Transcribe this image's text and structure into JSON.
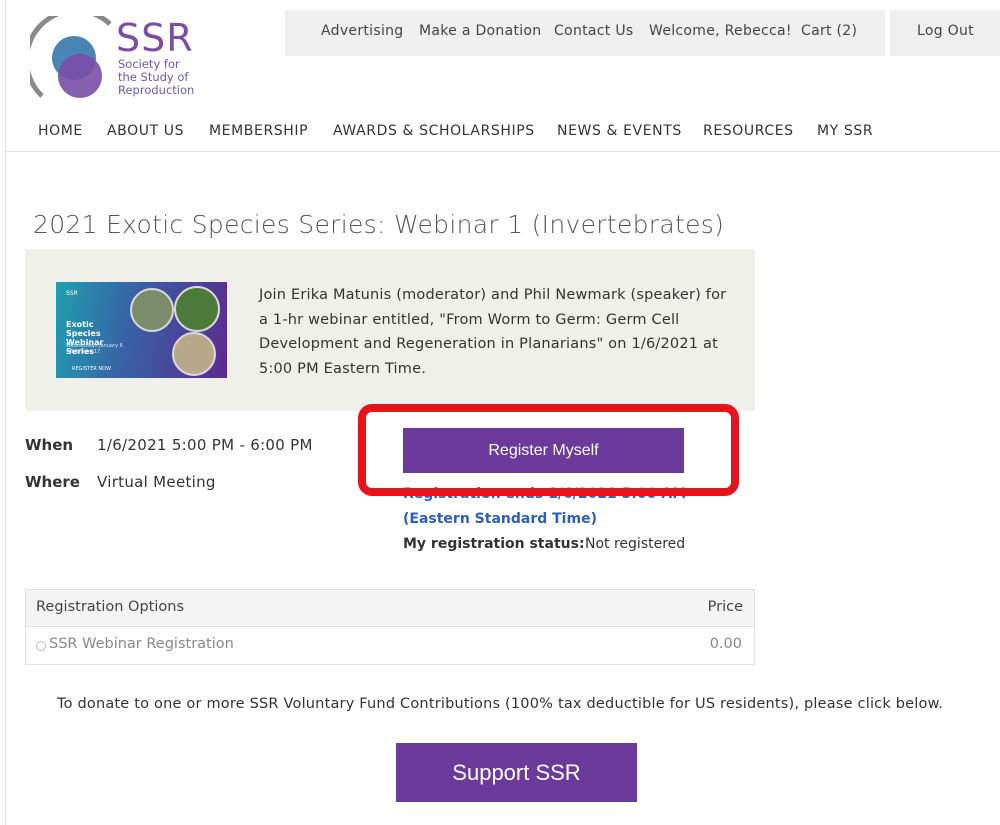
{
  "brand": {
    "name": "SSR",
    "subtitle_lines": [
      "Society for",
      "the Study of",
      "Reproduction"
    ]
  },
  "topbar": {
    "advertising": "Advertising",
    "donation": "Make a Donation",
    "contact": "Contact Us",
    "welcome": "Welcome, Rebecca!",
    "cart": "Cart (2)",
    "logout": "Log Out"
  },
  "nav": {
    "items": [
      "HOME",
      "ABOUT US",
      "MEMBERSHIP",
      "AWARDS & SCHOLARSHIPS",
      "NEWS & EVENTS",
      "RESOURCES",
      "MY SSR"
    ]
  },
  "event": {
    "title": "2021 Exotic Species Series: Webinar 1 (Invertebrates)",
    "thumbnail": {
      "logo": "SSR",
      "title": "Exotic Species Webinar Series",
      "dates": "Wednesdays January 6 – February 17",
      "cta": "REGISTER NOW"
    },
    "description": "Join Erika Matunis (moderator) and Phil Newmark (speaker) for a 1-hr webinar entitled, \"From Worm to Germ: Germ Cell Development and Regeneration in Planarians\" on 1/6/2021 at 5:00 PM Eastern Time.",
    "when_label": "When",
    "when_value": "1/6/2021 5:00 PM - 6:00 PM",
    "where_label": "Where",
    "where_value": "Virtual Meeting",
    "register_button": "Register Myself",
    "registration_ends": "Registration ends 1/6/2021 5:00 AM",
    "timezone": "(Eastern Standard Time)",
    "status_label": "My registration status:",
    "status_value": "Not registered"
  },
  "registration_table": {
    "header_option": "Registration Options",
    "header_price": "Price",
    "rows": [
      {
        "option": "SSR Webinar Registration",
        "price": "0.00"
      }
    ]
  },
  "donate": {
    "text": "To donate to one or more SSR Voluntary Fund Contributions (100% tax deductible for US residents), please click below.",
    "button": "Support SSR"
  },
  "colors": {
    "brand_purple": "#6c3a9a",
    "highlight_red": "#e8141b",
    "link_blue": "#2d5fb5"
  }
}
